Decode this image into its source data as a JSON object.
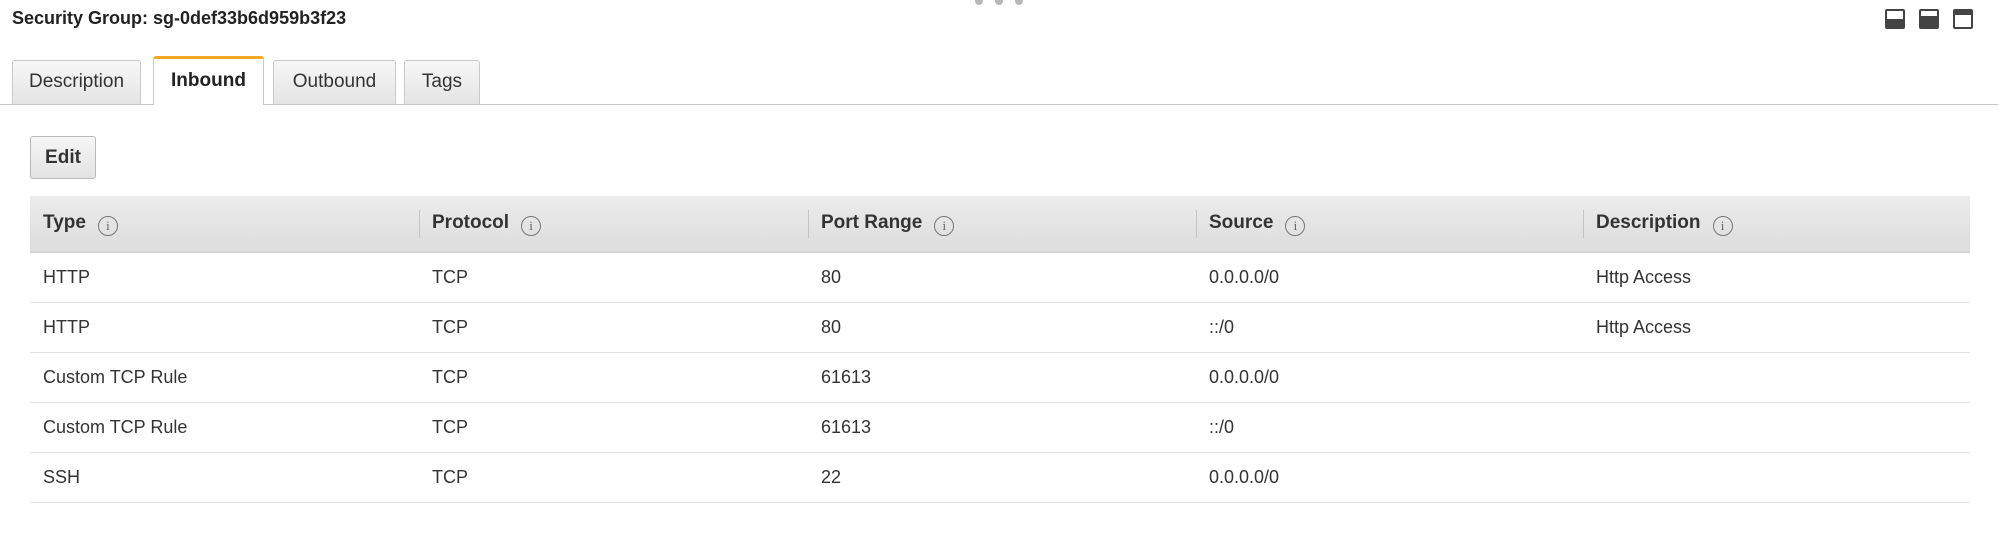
{
  "title": "Security Group: sg-0def33b6d959b3f23",
  "tabs": [
    {
      "label": "Description"
    },
    {
      "label": "Inbound"
    },
    {
      "label": "Outbound"
    },
    {
      "label": "Tags"
    }
  ],
  "active_tab": "Inbound",
  "actions": {
    "edit_label": "Edit"
  },
  "table": {
    "columns": [
      {
        "label": "Type"
      },
      {
        "label": "Protocol"
      },
      {
        "label": "Port Range"
      },
      {
        "label": "Source"
      },
      {
        "label": "Description"
      }
    ],
    "info_glyph": "i",
    "rows": [
      {
        "type": "HTTP",
        "protocol": "TCP",
        "port_range": "80",
        "source": "0.0.0.0/0",
        "description": "Http Access"
      },
      {
        "type": "HTTP",
        "protocol": "TCP",
        "port_range": "80",
        "source": "::/0",
        "description": "Http Access"
      },
      {
        "type": "Custom TCP Rule",
        "protocol": "TCP",
        "port_range": "61613",
        "source": "0.0.0.0/0",
        "description": ""
      },
      {
        "type": "Custom TCP Rule",
        "protocol": "TCP",
        "port_range": "61613",
        "source": "::/0",
        "description": ""
      },
      {
        "type": "SSH",
        "protocol": "TCP",
        "port_range": "22",
        "source": "0.0.0.0/0",
        "description": ""
      }
    ]
  },
  "colors": {
    "accent": "#f5a623",
    "header_bg": "#e4e4e4",
    "row_border": "#e2e2e2"
  },
  "icons": [
    "info-icon",
    "panel-bottom-icon",
    "panel-half-icon",
    "panel-top-icon"
  ]
}
